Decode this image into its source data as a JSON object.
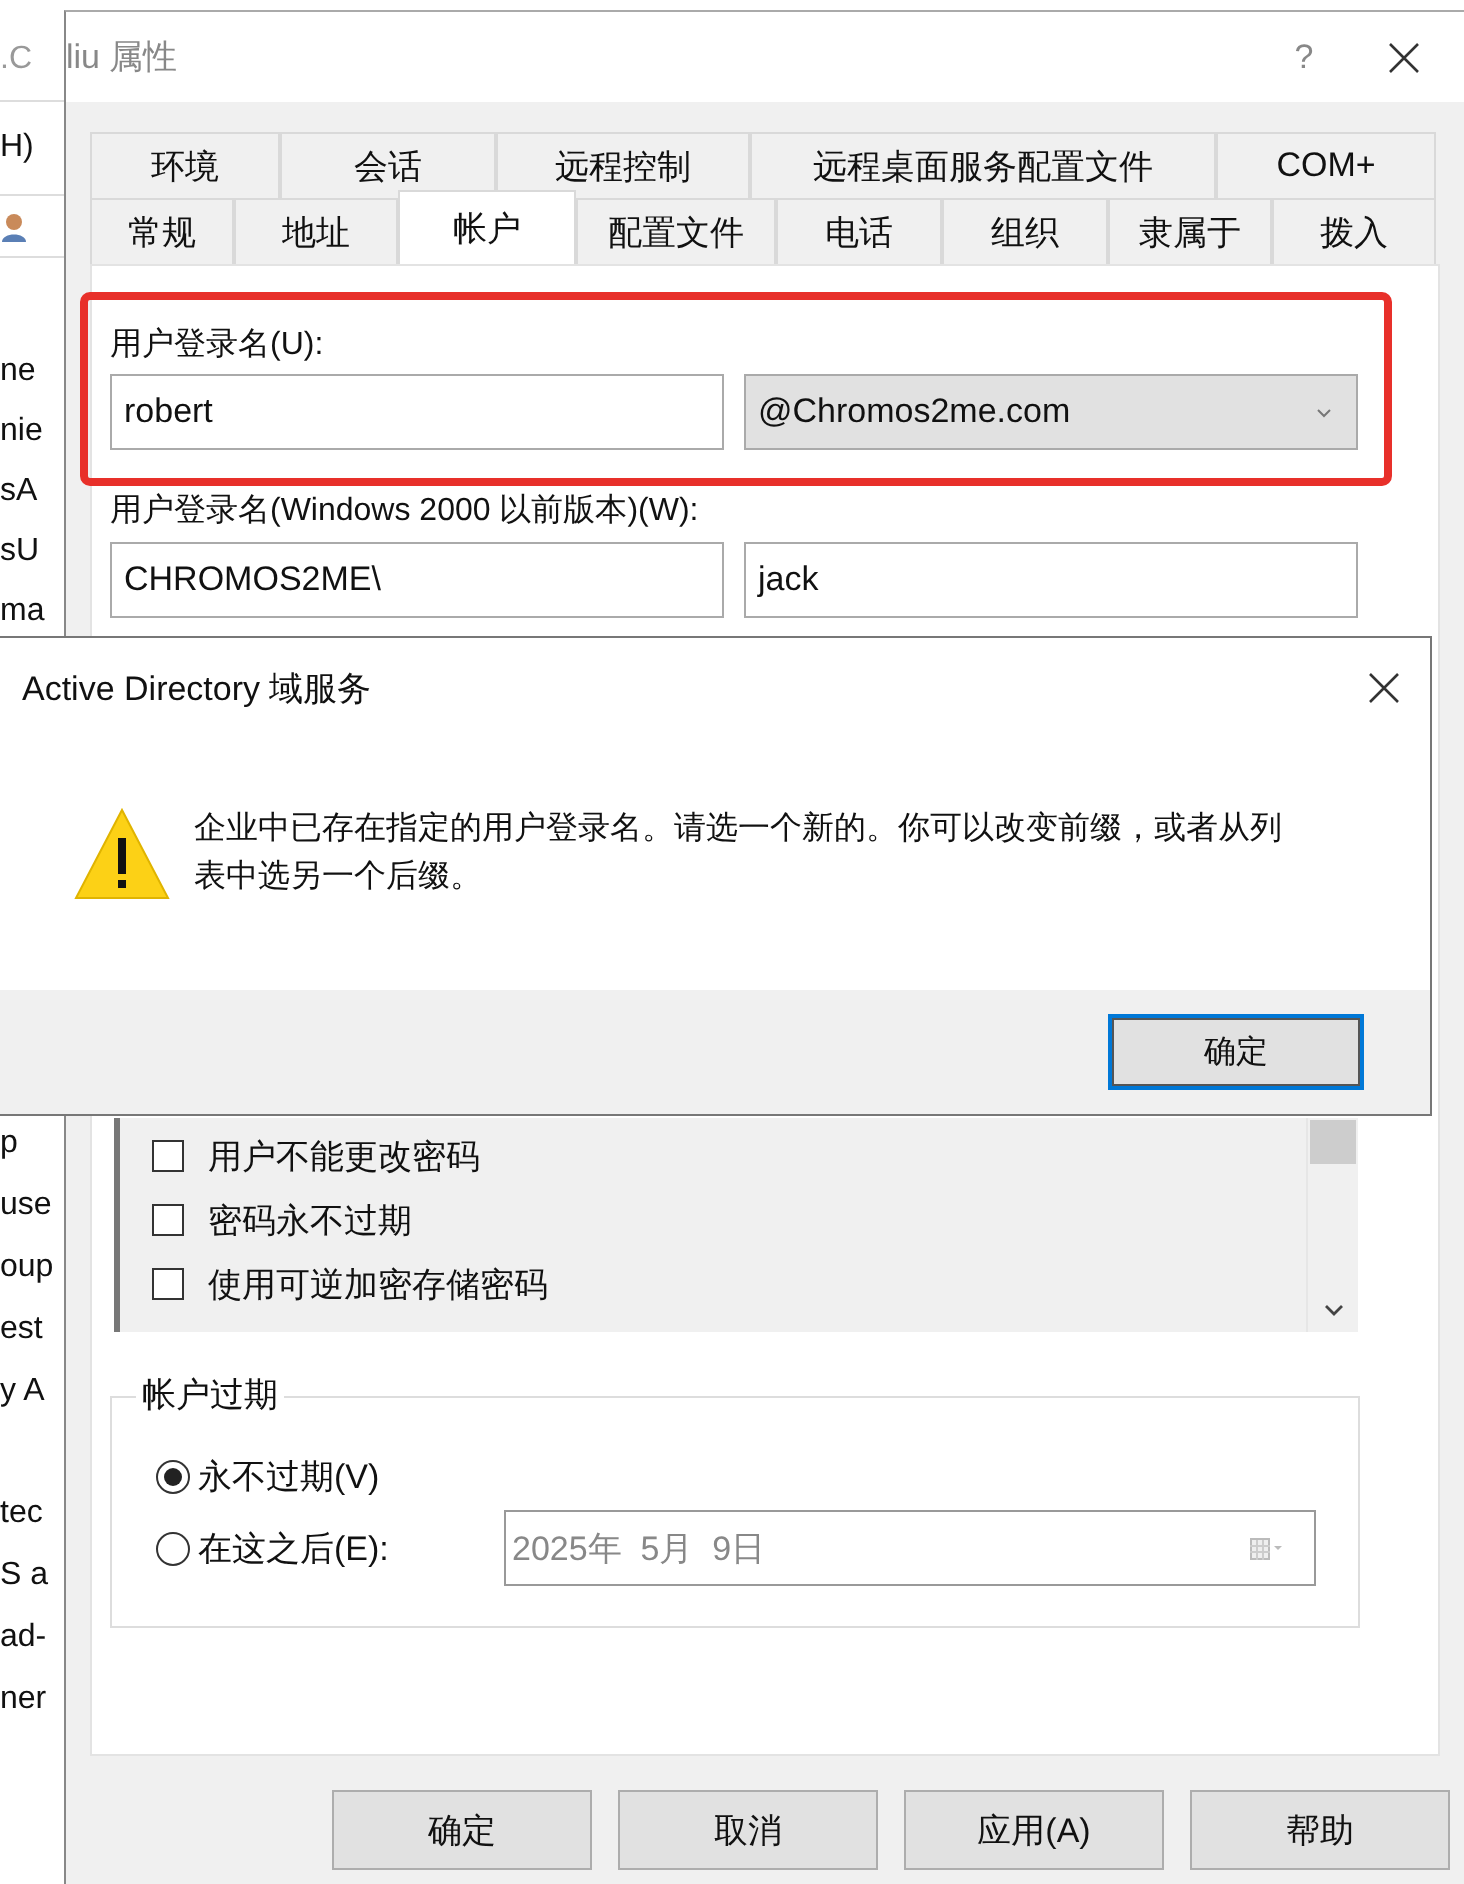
{
  "background_window": {
    "title": ".C",
    "menu": "H)",
    "list": [
      "ne",
      "nie",
      "sA",
      "sU",
      "ma",
      "p",
      "use",
      "oup",
      "est",
      "y A",
      "tec",
      "S a",
      "ad-",
      "ner"
    ]
  },
  "properties": {
    "title": "liu 属性",
    "help": "?",
    "tab_rows": [
      [
        {
          "label": "环境",
          "selected": false
        },
        {
          "label": "会话",
          "selected": false
        },
        {
          "label": "远程控制",
          "selected": false
        },
        {
          "label": "远程桌面服务配置文件",
          "selected": false
        },
        {
          "label": "COM+",
          "selected": false
        }
      ],
      [
        {
          "label": "常规",
          "selected": false
        },
        {
          "label": "地址",
          "selected": false
        },
        {
          "label": "帐户",
          "selected": true
        },
        {
          "label": "配置文件",
          "selected": false
        },
        {
          "label": "电话",
          "selected": false
        },
        {
          "label": "组织",
          "selected": false
        },
        {
          "label": "隶属于",
          "selected": false
        },
        {
          "label": "拨入",
          "selected": false
        }
      ]
    ],
    "logon_name": {
      "label": "用户登录名(U):",
      "value": "robert",
      "suffix": "@Chromos2me.com",
      "highlighted": true
    },
    "pre2000_name": {
      "label": "用户登录名(Windows 2000 以前版本)(W):",
      "domain": "CHROMOS2ME\\",
      "value": "jack"
    },
    "account_options": [
      {
        "label": "用户不能更改密码",
        "checked": false
      },
      {
        "label": "密码永不过期",
        "checked": false
      },
      {
        "label": "使用可逆加密存储密码",
        "checked": false
      }
    ],
    "expiry": {
      "title": "帐户过期",
      "options": [
        {
          "label": "永不过期(V)",
          "selected": true
        },
        {
          "label": "在这之后(E):",
          "selected": false
        }
      ],
      "date": "2025年  5月  9日",
      "date_disabled": true
    },
    "buttons": [
      "确定",
      "取消",
      "应用(A)",
      "帮助"
    ]
  },
  "alert": {
    "title": "Active Directory 域服务",
    "message": "企业中已存在指定的用户登录名。请选一个新的。你可以改变前缀，或者从列表中选另一个后缀。",
    "button": "确定"
  }
}
